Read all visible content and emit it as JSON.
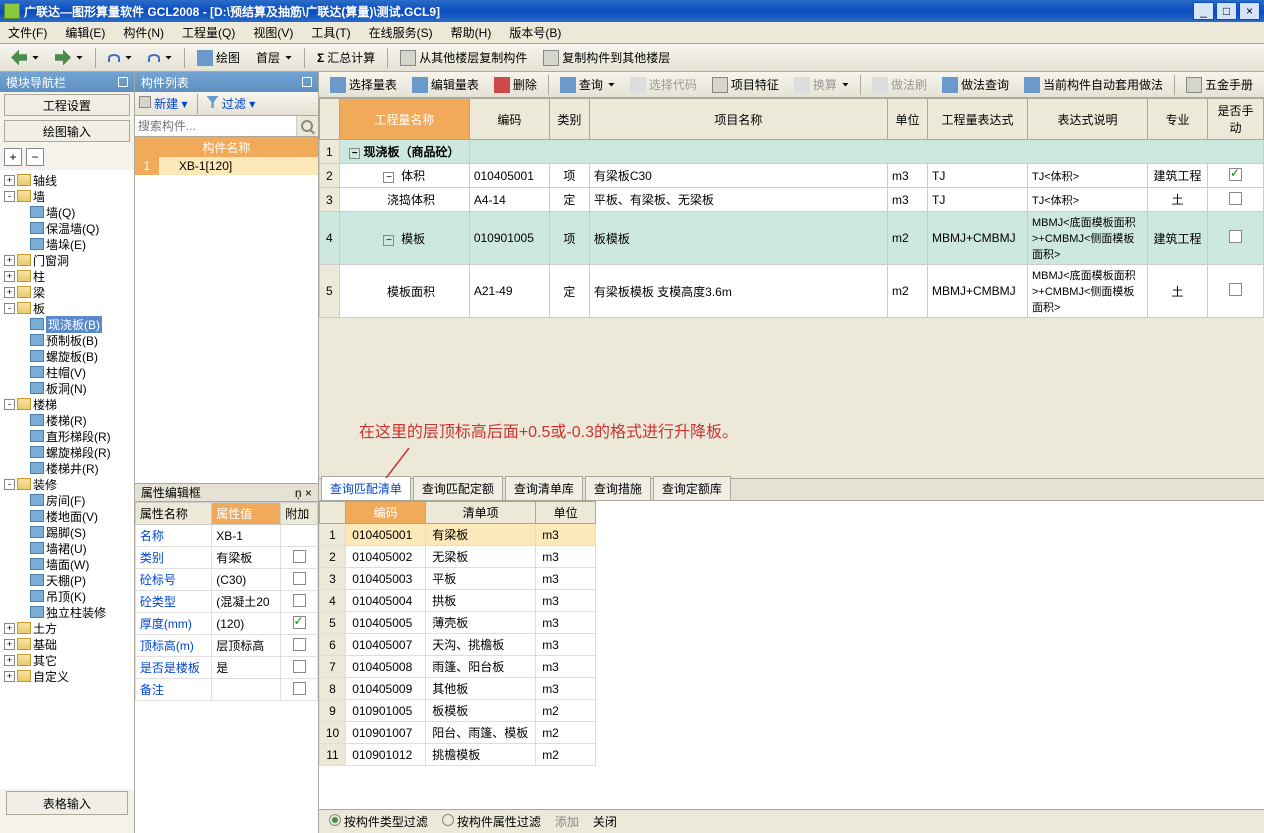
{
  "titlebar": {
    "title": "广联达—图形算量软件 GCL2008 - [D:\\预结算及抽筋\\广联达(算量)\\测试.GCL9]"
  },
  "menubar": {
    "items": [
      "文件(F)",
      "编辑(E)",
      "构件(N)",
      "工程量(Q)",
      "视图(V)",
      "工具(T)",
      "在线服务(S)",
      "帮助(H)",
      "版本号(B)"
    ]
  },
  "toolbar1": {
    "draw": "绘图",
    "floor": "首层",
    "calc": "汇总计算",
    "copy_from": "从其他楼层复制构件",
    "copy_to": "复制构件到其他楼层"
  },
  "left": {
    "panel_title": "模块导航栏",
    "tab1": "工程设置",
    "tab2": "绘图输入",
    "bottom_tab": "表格输入",
    "tree": [
      {
        "lvl": 0,
        "t": "+",
        "icon": "folder",
        "label": "轴线"
      },
      {
        "lvl": 0,
        "t": "-",
        "icon": "folder",
        "label": "墙"
      },
      {
        "lvl": 1,
        "t": "",
        "icon": "item",
        "label": "墙(Q)"
      },
      {
        "lvl": 1,
        "t": "",
        "icon": "item",
        "label": "保温墙(Q)"
      },
      {
        "lvl": 1,
        "t": "",
        "icon": "item",
        "label": "墙垛(E)"
      },
      {
        "lvl": 0,
        "t": "+",
        "icon": "folder",
        "label": "门窗洞"
      },
      {
        "lvl": 0,
        "t": "+",
        "icon": "folder",
        "label": "柱"
      },
      {
        "lvl": 0,
        "t": "+",
        "icon": "folder",
        "label": "梁"
      },
      {
        "lvl": 0,
        "t": "-",
        "icon": "folder",
        "label": "板"
      },
      {
        "lvl": 1,
        "t": "",
        "icon": "item",
        "label": "现浇板(B)",
        "sel": true
      },
      {
        "lvl": 1,
        "t": "",
        "icon": "item",
        "label": "预制板(B)"
      },
      {
        "lvl": 1,
        "t": "",
        "icon": "item",
        "label": "螺旋板(B)"
      },
      {
        "lvl": 1,
        "t": "",
        "icon": "item",
        "label": "柱帽(V)"
      },
      {
        "lvl": 1,
        "t": "",
        "icon": "item",
        "label": "板洞(N)"
      },
      {
        "lvl": 0,
        "t": "-",
        "icon": "folder",
        "label": "楼梯"
      },
      {
        "lvl": 1,
        "t": "",
        "icon": "item",
        "label": "楼梯(R)"
      },
      {
        "lvl": 1,
        "t": "",
        "icon": "item",
        "label": "直形梯段(R)"
      },
      {
        "lvl": 1,
        "t": "",
        "icon": "item",
        "label": "螺旋梯段(R)"
      },
      {
        "lvl": 1,
        "t": "",
        "icon": "item",
        "label": "楼梯井(R)"
      },
      {
        "lvl": 0,
        "t": "-",
        "icon": "folder",
        "label": "装修"
      },
      {
        "lvl": 1,
        "t": "",
        "icon": "item",
        "label": "房间(F)"
      },
      {
        "lvl": 1,
        "t": "",
        "icon": "item",
        "label": "楼地面(V)"
      },
      {
        "lvl": 1,
        "t": "",
        "icon": "item",
        "label": "踢脚(S)"
      },
      {
        "lvl": 1,
        "t": "",
        "icon": "item",
        "label": "墙裙(U)"
      },
      {
        "lvl": 1,
        "t": "",
        "icon": "item",
        "label": "墙面(W)"
      },
      {
        "lvl": 1,
        "t": "",
        "icon": "item",
        "label": "天棚(P)"
      },
      {
        "lvl": 1,
        "t": "",
        "icon": "item",
        "label": "吊顶(K)"
      },
      {
        "lvl": 1,
        "t": "",
        "icon": "item",
        "label": "独立柱装修"
      },
      {
        "lvl": 0,
        "t": "+",
        "icon": "folder",
        "label": "土方"
      },
      {
        "lvl": 0,
        "t": "+",
        "icon": "folder",
        "label": "基础"
      },
      {
        "lvl": 0,
        "t": "+",
        "icon": "folder",
        "label": "其它"
      },
      {
        "lvl": 0,
        "t": "+",
        "icon": "folder",
        "label": "自定义"
      }
    ]
  },
  "mid": {
    "panel_title": "构件列表",
    "new": "新建",
    "filter": "过滤",
    "search_placeholder": "搜索构件...",
    "hdr": "构件名称",
    "rows": [
      {
        "n": "1",
        "name": "XB-1[120]"
      }
    ]
  },
  "props": {
    "title": "属性编辑框",
    "cols": {
      "name": "属性名称",
      "value": "属性值",
      "extra": "附加"
    },
    "rows": [
      {
        "name": "名称",
        "value": "XB-1",
        "chk": ""
      },
      {
        "name": "类别",
        "value": "有梁板",
        "chk": "off"
      },
      {
        "name": "砼标号",
        "value": "(C30)",
        "chk": "off"
      },
      {
        "name": "砼类型",
        "value": "(混凝土20",
        "chk": "off"
      },
      {
        "name": "厚度(mm)",
        "value": "(120)",
        "chk": "on"
      },
      {
        "name": "顶标高(m)",
        "value": "层顶标高",
        "chk": "off"
      },
      {
        "name": "是否是楼板",
        "value": "是",
        "chk": "off"
      },
      {
        "name": "备注",
        "value": "",
        "chk": "off"
      }
    ]
  },
  "right_tb": {
    "select": "选择量表",
    "edit": "编辑量表",
    "delete": "删除",
    "query": "查询",
    "sel_code": "选择代码",
    "feat": "项目特征",
    "convert": "换算",
    "brush": "做法刷",
    "method_q": "做法查询",
    "auto": "当前构件自动套用做法",
    "hw": "五金手册"
  },
  "maingrid": {
    "cols": {
      "eng": "工程量名称",
      "code": "编码",
      "type": "类别",
      "proj": "项目名称",
      "unit": "单位",
      "expr": "工程量表达式",
      "desc": "表达式说明",
      "spec": "专业",
      "manual": "是否手动"
    },
    "rows": [
      {
        "n": "1",
        "group": true,
        "eng": "现浇板（商品砼）"
      },
      {
        "n": "2",
        "eng": "体积",
        "code": "010405001",
        "type": "项",
        "proj": "有梁板C30",
        "unit": "m3",
        "expr": "TJ",
        "desc": "TJ<体积>",
        "spec": "建筑工程",
        "chk": "on"
      },
      {
        "n": "3",
        "eng": "浇捣体积",
        "code": "A4-14",
        "type": "定",
        "proj": "平板、有梁板、无梁板",
        "unit": "m3",
        "expr": "TJ",
        "desc": "TJ<体积>",
        "spec": "土",
        "chk": "off"
      },
      {
        "n": "4",
        "eng": "模板",
        "code": "010901005",
        "type": "项",
        "proj": "板模板",
        "unit": "m2",
        "expr": "MBMJ+CMBMJ",
        "desc": "MBMJ<底面模板面积>+CMBMJ<侧面模板面积>",
        "spec": "建筑工程",
        "chk": "off",
        "hl": true
      },
      {
        "n": "5",
        "eng": "模板面积",
        "code": "A21-49",
        "type": "定",
        "proj": "有梁板模板 支模高度3.6m",
        "unit": "m2",
        "expr": "MBMJ+CMBMJ",
        "desc": "MBMJ<底面模板面积>+CMBMJ<侧面模板面积>",
        "spec": "土",
        "chk": "off"
      }
    ]
  },
  "annotation": "在这里的层顶标高后面+0.5或-0.3的格式进行升降板。",
  "query": {
    "tabs": [
      "查询匹配清单",
      "查询匹配定额",
      "查询清单库",
      "查询措施",
      "查询定额库"
    ],
    "cols": {
      "code": "编码",
      "item": "清单项",
      "unit": "单位"
    },
    "rows": [
      {
        "n": "1",
        "code": "010405001",
        "item": "有梁板",
        "unit": "m3",
        "hl": true
      },
      {
        "n": "2",
        "code": "010405002",
        "item": "无梁板",
        "unit": "m3"
      },
      {
        "n": "3",
        "code": "010405003",
        "item": "平板",
        "unit": "m3"
      },
      {
        "n": "4",
        "code": "010405004",
        "item": "拱板",
        "unit": "m3"
      },
      {
        "n": "5",
        "code": "010405005",
        "item": "薄壳板",
        "unit": "m3"
      },
      {
        "n": "6",
        "code": "010405007",
        "item": "天沟、挑檐板",
        "unit": "m3"
      },
      {
        "n": "7",
        "code": "010405008",
        "item": "雨篷、阳台板",
        "unit": "m3"
      },
      {
        "n": "8",
        "code": "010405009",
        "item": "其他板",
        "unit": "m3"
      },
      {
        "n": "9",
        "code": "010901005",
        "item": "板模板",
        "unit": "m2"
      },
      {
        "n": "10",
        "code": "010901007",
        "item": "阳台、雨篷、模板",
        "unit": "m2"
      },
      {
        "n": "11",
        "code": "010901012",
        "item": "挑檐模板",
        "unit": "m2"
      }
    ]
  },
  "filter": {
    "by_type": "按构件类型过滤",
    "by_prop": "按构件属性过滤",
    "add": "添加",
    "close": "关闭"
  }
}
